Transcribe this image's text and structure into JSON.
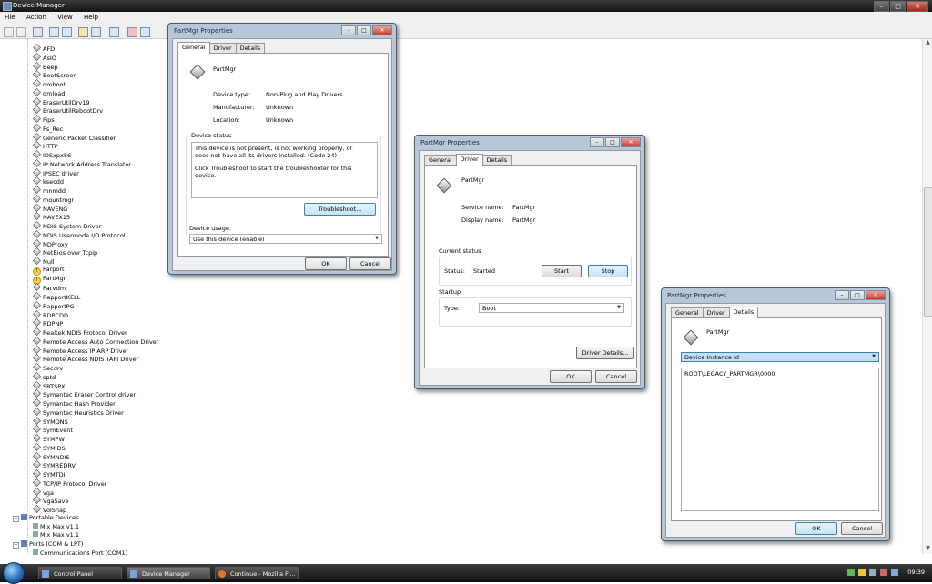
{
  "window": {
    "title": "Device Manager"
  },
  "menu": [
    "File",
    "Action",
    "View",
    "Help"
  ],
  "tree": {
    "items": [
      "AFD",
      "AsIO",
      "Beep",
      "BootScreen",
      "dmboot",
      "dmload",
      "EraserUtilDrv19",
      "EraserUtilRebootDrv",
      "Fips",
      "Fs_Rec",
      "Generic Packet Classifier",
      "HTTP",
      "IDSxpx86",
      "IP Network Address Translator",
      "IPSEC driver",
      "ksecdd",
      "mnmdd",
      "mountmgr",
      "NAVENG",
      "NAVEX15",
      "NDIS System Driver",
      "NDIS Usermode I/O Protocol",
      "NDProxy",
      "NetBios over Tcpip",
      "Null",
      "Parport",
      "PartMgr",
      "ParVdm",
      "RapportKELL",
      "RapportPG",
      "RDPCDD",
      "RDPNP",
      "Realtek NDIS Protocol Driver",
      "Remote Access Auto Connection Driver",
      "Remote Access IP ARP Driver",
      "Remote Access NDIS TAPI Driver",
      "Secdrv",
      "sptd",
      "SRTSPX",
      "Symantec Eraser Control driver",
      "Symantec Hash Provider",
      "Symantec Heuristics Driver",
      "SYMDNS",
      "SymEvent",
      "SYMFW",
      "SYMIDS",
      "SYMNDIS",
      "SYMREDRV",
      "SYMTDI",
      "TCP/IP Protocol Driver",
      "vga",
      "VgaSave",
      "VolSnap"
    ],
    "categories": [
      {
        "label": "Portable Devices",
        "children": [
          "Mix Max v1.1",
          "Mix Max v1.1"
        ]
      },
      {
        "label": "Ports (COM & LPT)",
        "children": [
          "Communications Port (COM1)"
        ]
      }
    ]
  },
  "dialog_general": {
    "title": "PartMgr Properties",
    "tabs": [
      "General",
      "Driver",
      "Details"
    ],
    "device_name": "PartMgr",
    "device_type_label": "Device type:",
    "device_type": "Non-Plug and Play Drivers",
    "manufacturer_label": "Manufacturer:",
    "manufacturer": "Unknown",
    "location_label": "Location:",
    "location": "Unknown",
    "status_group": "Device status",
    "status_text_1": "This device is not present, is not working properly, or does not have all its drivers installed. (Code 24)",
    "status_text_2": "Click Troubleshoot to start the troubleshooter for this device.",
    "troubleshoot": "Troubleshoot...",
    "usage_label": "Device usage:",
    "usage_value": "Use this device (enable)",
    "ok": "OK",
    "cancel": "Cancel"
  },
  "dialog_driver": {
    "title": "PartMgr Properties",
    "tabs": [
      "General",
      "Driver",
      "Details"
    ],
    "device_name": "PartMgr",
    "service_label": "Service name:",
    "service_value": "PartMgr",
    "display_label": "Display name:",
    "display_value": "PartMgr",
    "current_status": "Current status",
    "status_label": "Status:",
    "status_value": "Started",
    "start": "Start",
    "stop": "Stop",
    "startup": "Startup",
    "type_label": "Type:",
    "type_value": "Boot",
    "driver_details": "Driver Details...",
    "ok": "OK",
    "cancel": "Cancel"
  },
  "dialog_details": {
    "title": "PartMgr Properties",
    "tabs": [
      "General",
      "Driver",
      "Details"
    ],
    "device_name": "PartMgr",
    "property": "Device Instance Id",
    "value": "ROOT\\LEGACY_PARTMGR\\0000",
    "ok": "OK",
    "cancel": "Cancel"
  },
  "taskbar": {
    "tasks": [
      "Control Panel",
      "Device Manager",
      "Continue - Mozilla Fi..."
    ],
    "clock": "09:39"
  },
  "colors": {
    "accent": "#3c7fb1",
    "title_bar": "#1e1e1e",
    "warning": "#f3d23a"
  }
}
